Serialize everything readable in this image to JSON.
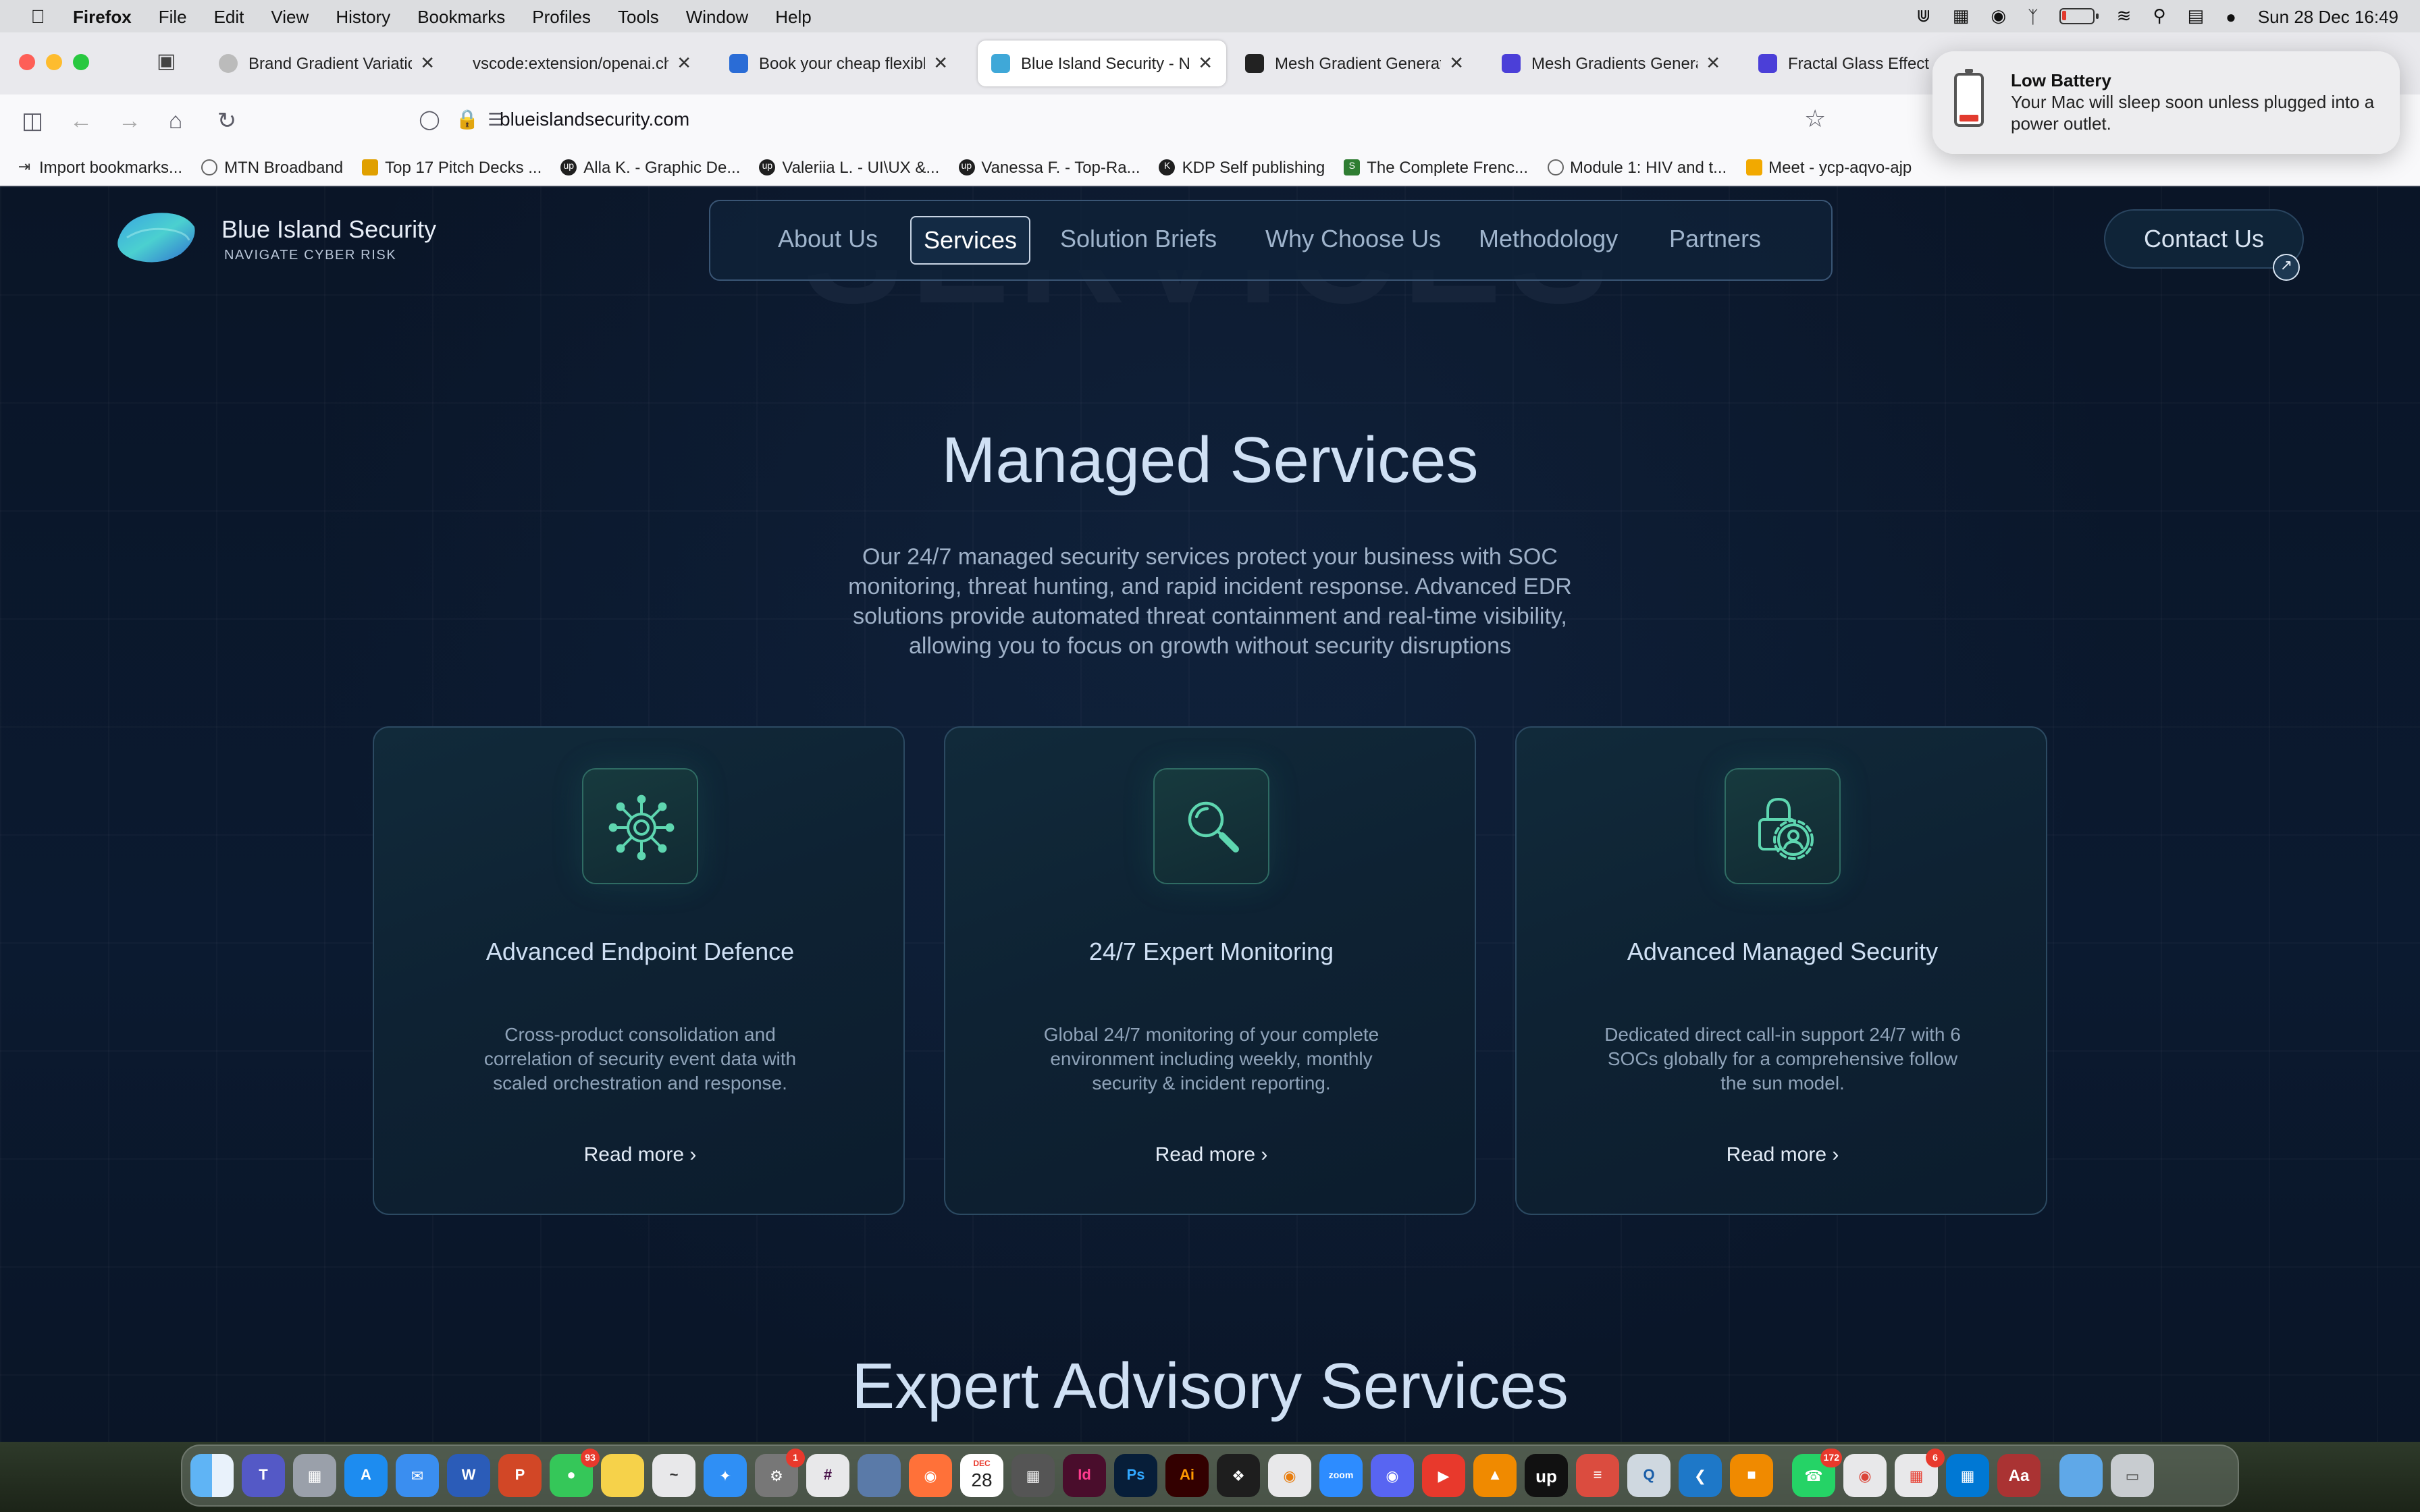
{
  "menubar": {
    "app": "Firefox",
    "items": [
      "File",
      "Edit",
      "View",
      "History",
      "Bookmarks",
      "Profiles",
      "Tools",
      "Window",
      "Help"
    ],
    "datetime": "Sun 28 Dec  16:49"
  },
  "tabs": [
    {
      "title": "Brand Gradient Variations",
      "active": false
    },
    {
      "title": "vscode:extension/openai.chat",
      "active": false
    },
    {
      "title": "Book your cheap flexible",
      "active": false
    },
    {
      "title": "Blue Island Security - Na",
      "active": true
    },
    {
      "title": "Mesh Gradient Generator",
      "active": false
    },
    {
      "title": "Mesh Gradients Generato",
      "active": false
    },
    {
      "title": "Fractal Glass Effect G",
      "active": false
    }
  ],
  "address": {
    "url": "blueislandsecurity.com"
  },
  "bookmarks": [
    "Import bookmarks...",
    "MTN Broadband",
    "Top 17 Pitch Decks ...",
    "Alla K. - Graphic De...",
    "Valeriia L. - UI\\UX &...",
    "Vanessa F. - Top-Ra...",
    "KDP Self publishing",
    "The Complete Frenc...",
    "Module 1: HIV and t...",
    "Meet - ycp-aqvo-ajp"
  ],
  "notification": {
    "title": "Low Battery",
    "body": "Your Mac will sleep soon unless plugged into a power outlet."
  },
  "site": {
    "brand": "Blue Island Security",
    "tagline": "NAVIGATE CYBER RISK",
    "nav": [
      "About Us",
      "Services",
      "Solution Briefs",
      "Why Choose Us",
      "Methodology",
      "Partners"
    ],
    "nav_selected": "Services",
    "contact": "Contact Us",
    "ghost_heading": "SERVICES",
    "section1_title": "Managed Services",
    "section1_lead": "Our 24/7 managed security services protect your business with SOC monitoring, threat hunting, and rapid incident response. Advanced EDR solutions provide automated threat containment and real-time visibility, allowing you to focus on growth without security disruptions",
    "cards": [
      {
        "title": "Advanced Endpoint Defence",
        "desc": "Cross-product consolidation and correlation of security event data with scaled orchestration and response.",
        "cta": "Read more",
        "icon": "virus-gear-icon"
      },
      {
        "title": "24/7 Expert Monitoring",
        "desc": "Global 24/7 monitoring of your complete environment including weekly, monthly security & incident reporting.",
        "cta": "Read more",
        "icon": "magnifier-icon"
      },
      {
        "title": "Advanced Managed Security",
        "desc": "Dedicated direct call-in support 24/7 with 6 SOCs globally for a comprehensive follow the sun model.",
        "cta": "Read more",
        "icon": "lock-user-gear-icon"
      }
    ],
    "section2_title": "Expert Advisory Services"
  },
  "dock": {
    "badges": {
      "messages": "93",
      "settings": "1",
      "whatsapp": "172",
      "slack_like": "6"
    },
    "calendar_day": "28",
    "calendar_month": "DEC"
  },
  "colors": {
    "page_bg": "#0b1628",
    "accent_teal": "#5ed6b0",
    "heading": "#cfe0f4"
  }
}
